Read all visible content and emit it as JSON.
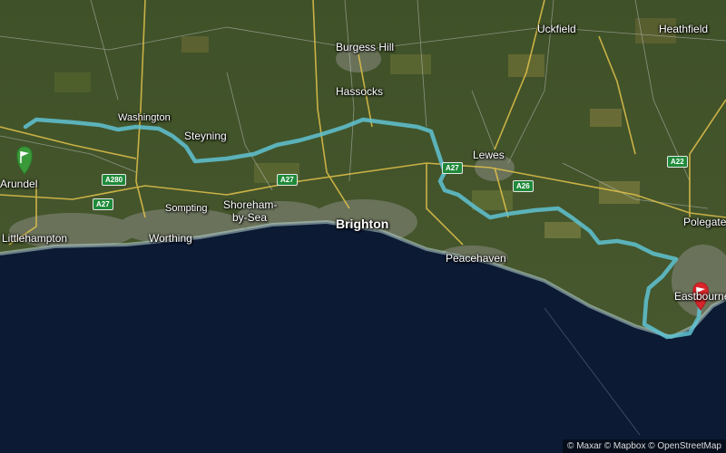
{
  "map": {
    "places": [
      {
        "id": "arundel",
        "label": "Arundel"
      },
      {
        "id": "littlehampton",
        "label": "Littlehampton"
      },
      {
        "id": "worthing",
        "label": "Worthing"
      },
      {
        "id": "sompting",
        "label": "Sompting"
      },
      {
        "id": "shoreham1",
        "label": "Shoreham-"
      },
      {
        "id": "shoreham2",
        "label": "by-Sea"
      },
      {
        "id": "washington",
        "label": "Washington"
      },
      {
        "id": "steyning",
        "label": "Steyning"
      },
      {
        "id": "burgess_hill",
        "label": "Burgess Hill"
      },
      {
        "id": "hassocks",
        "label": "Hassocks"
      },
      {
        "id": "brighton",
        "label": "Brighton"
      },
      {
        "id": "lewes",
        "label": "Lewes"
      },
      {
        "id": "peacehaven",
        "label": "Peacehaven"
      },
      {
        "id": "uckfield",
        "label": "Uckfield"
      },
      {
        "id": "heathfield",
        "label": "Heathfield"
      },
      {
        "id": "polegate",
        "label": "Polegate"
      },
      {
        "id": "eastbourne",
        "label": "Eastbourne"
      }
    ],
    "roads": [
      {
        "id": "a280",
        "label": "A280"
      },
      {
        "id": "a27_w",
        "label": "A27"
      },
      {
        "id": "a27_c",
        "label": "A27"
      },
      {
        "id": "a27_e",
        "label": "A27"
      },
      {
        "id": "a26",
        "label": "A26"
      },
      {
        "id": "a22",
        "label": "A22"
      }
    ],
    "route": {
      "color": "#5fc3d3",
      "start_color": "#3a9a3a",
      "end_color": "#d8252a"
    },
    "attribution": "© Maxar © Mapbox © OpenStreetMap"
  }
}
